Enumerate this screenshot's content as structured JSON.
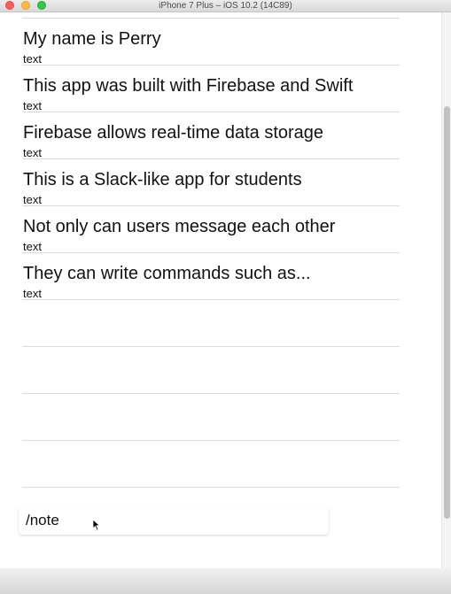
{
  "window": {
    "title": "iPhone 7 Plus – iOS 10.2 (14C89)"
  },
  "messages": [
    {
      "title": "My name is Perry",
      "subtitle": "text"
    },
    {
      "title": "This app was built with Firebase and Swift",
      "subtitle": "text"
    },
    {
      "title": "Firebase allows real-time data storage",
      "subtitle": "text"
    },
    {
      "title": "This is a Slack-like app for students",
      "subtitle": "text"
    },
    {
      "title": "Not only can users message each other",
      "subtitle": "text"
    },
    {
      "title": "They can write commands such as...",
      "subtitle": "text"
    }
  ],
  "composer": {
    "value": "/note"
  },
  "icons": {
    "close": "close-icon",
    "minimize": "minimize-icon",
    "maximize": "maximize-icon",
    "pointer": "mouse-pointer-icon"
  }
}
